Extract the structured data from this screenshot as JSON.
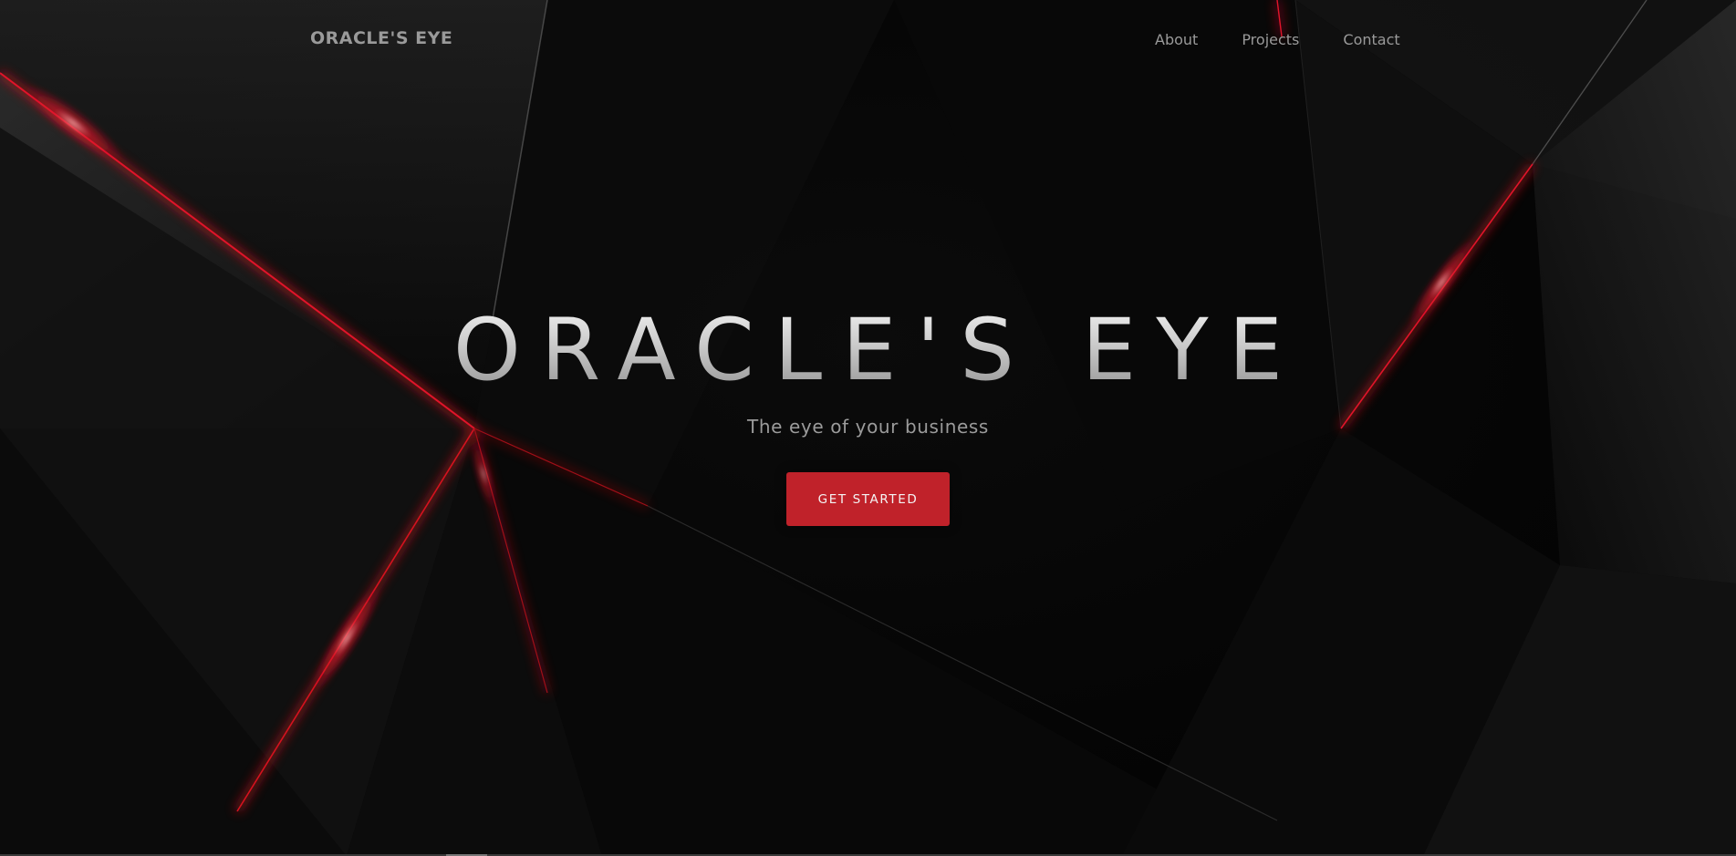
{
  "brand": {
    "name": "ORACLE'S EYE"
  },
  "nav": {
    "items": [
      {
        "label": "About"
      },
      {
        "label": "Projects"
      },
      {
        "label": "Contact"
      }
    ]
  },
  "hero": {
    "title": "ORACLE'S EYE",
    "subtitle": "The eye of your business",
    "cta_label": "GET STARTED"
  },
  "colors": {
    "accent": "#c0222a",
    "background": "#050505",
    "text_muted": "#9a9a9a",
    "glow_red": "#e0142a"
  }
}
